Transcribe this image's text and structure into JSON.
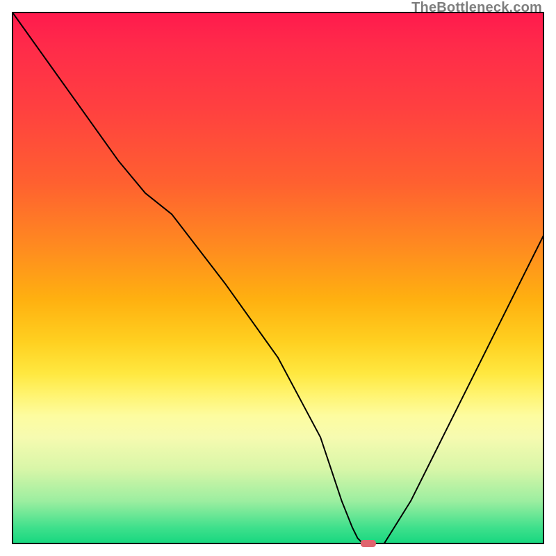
{
  "watermark": "TheBottleneck.com",
  "colors": {
    "gradient_top": "#ff1a4d",
    "gradient_bottom": "#17d77f",
    "curve": "#000000",
    "marker": "#e0646e",
    "watermark_text": "#7e7e7e"
  },
  "chart_data": {
    "type": "line",
    "title": "",
    "xlabel": "",
    "ylabel": "",
    "xlim": [
      0,
      100
    ],
    "ylim": [
      0,
      100
    ],
    "grid": false,
    "legend": false,
    "series": [
      {
        "name": "bottleneck-curve",
        "x": [
          0,
          10,
          20,
          25,
          30,
          40,
          50,
          58,
          60,
          62,
          64,
          65,
          66,
          68,
          70,
          75,
          80,
          90,
          100
        ],
        "y": [
          100,
          86,
          72,
          66,
          62,
          49,
          35,
          20,
          14,
          8,
          3,
          1,
          0,
          0,
          0,
          8,
          18,
          38,
          58
        ]
      }
    ],
    "marker": {
      "name": "optimal-point",
      "x": 67,
      "y": 0,
      "shape": "rounded-pill"
    },
    "annotations": []
  }
}
